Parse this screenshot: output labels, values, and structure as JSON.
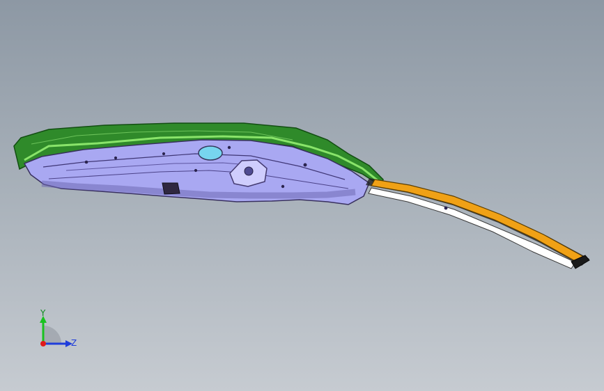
{
  "viewport": {
    "background_top": "#8d98a4",
    "background_bottom": "#c6cbd1"
  },
  "model": {
    "parts": [
      {
        "name": "outer-panel",
        "color": "#2f8a2a"
      },
      {
        "name": "inner-frame",
        "color": "#a9a8f2"
      },
      {
        "name": "seal-strip",
        "color": "#f0a116"
      },
      {
        "name": "rail-edge",
        "color": "#ffffff"
      }
    ]
  },
  "triad": {
    "y_label": "Y",
    "z_label": "Z",
    "y_color": "#19c21f",
    "z_color": "#1f3ddb",
    "x_color": "#e01b1b"
  }
}
